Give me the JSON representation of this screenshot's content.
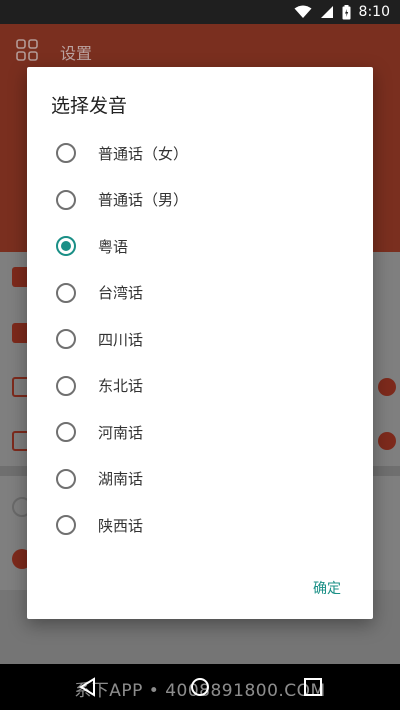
{
  "status_bar": {
    "time": "8:10",
    "icons": [
      "wifi-icon",
      "signal-icon",
      "battery-icon"
    ]
  },
  "background_app": {
    "title": "设置",
    "header_color": "#7a2f1f",
    "accent_toggle_color": "#7d2a1c"
  },
  "dialog": {
    "title": "选择发音",
    "options": [
      {
        "label": "普通话（女）",
        "checked": false
      },
      {
        "label": "普通话（男）",
        "checked": false
      },
      {
        "label": "粤语",
        "checked": true
      },
      {
        "label": "台湾话",
        "checked": false
      },
      {
        "label": "四川话",
        "checked": false
      },
      {
        "label": "东北话",
        "checked": false
      },
      {
        "label": "河南话",
        "checked": false
      },
      {
        "label": "湖南话",
        "checked": false
      },
      {
        "label": "陕西话",
        "checked": false
      }
    ],
    "confirm_label": "确定",
    "accent_color": "#1a8f86"
  },
  "watermark": "系下APP • 4008891800.COM",
  "nav_bar": {
    "buttons": [
      "back-icon",
      "home-icon",
      "recents-icon"
    ]
  }
}
